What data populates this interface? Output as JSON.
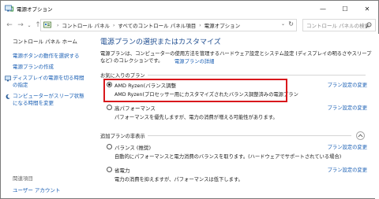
{
  "window": {
    "title": "電源オプション",
    "controls": {
      "minimize": "—",
      "maximize": "☐",
      "close": "✕"
    }
  },
  "nav": {
    "back_glyph": "←",
    "forward_glyph": "→",
    "history_glyph": "⌄",
    "up_glyph": "↑",
    "breadcrumb": [
      "コントロール パネル",
      "すべてのコントロール パネル項目",
      "電源オプション"
    ],
    "crumb_separator": "›",
    "dropdown_glyph": "⌄",
    "refresh_glyph": "↻",
    "search_placeholder": "コントロール パネルの検索"
  },
  "sidebar": {
    "home": "コントロール パネル ホーム",
    "items": [
      {
        "label": "電源ボタンの動作を選択する",
        "icon": "none"
      },
      {
        "label": "電源プランの作成",
        "icon": "none"
      },
      {
        "label": "ディスプレイの電源を切る時間の指定",
        "icon": "monitor-icon"
      },
      {
        "label": "コンピューターがスリープ状態になる時間を変更",
        "icon": "moon-icon"
      }
    ],
    "related_heading": "関連項目",
    "user_accounts": "ユーザー アカウント"
  },
  "main": {
    "title": "電源プランの選択またはカスタマイズ",
    "description": "電源プランは、コンピューターの使用方法を管理するハードウェア設定とシステム設定 (ディスプレイの明るさやスリープなど) のコレクションです。",
    "description_link": "電源プランの詳細",
    "favorites_label": "お気に入りのプラン",
    "additional_label": "追加プランの非表示",
    "change_label": "プラン設定の変更",
    "favorite_plans": [
      {
        "name": "AMD Ryzen(バランス調整",
        "description": "AMD Ryzen(プロセッサー用にカスタマイズされたバランス調整済みの電源プラン",
        "selected": true,
        "has_change_link": true
      },
      {
        "name": "高パフォーマンス",
        "description": "パフォーマンスを優先しますが、電力の消費が増える可能性があります。",
        "selected": false,
        "has_change_link": true
      }
    ],
    "additional_plans": [
      {
        "name": "バランス (推奨)",
        "description": "自動的にパフォーマンスと電力消費のバランスを取ります。(ハードウェアでサポートされている場合)",
        "selected": false,
        "has_change_link": true
      },
      {
        "name": "省電力",
        "description": "電力の消費を抑えますが、パフォーマンスは低下します。",
        "selected": false,
        "has_change_link": true
      }
    ]
  },
  "colors": {
    "link": "#1a5fb4",
    "title": "#1f4e91",
    "highlight_border": "#d9181c"
  }
}
